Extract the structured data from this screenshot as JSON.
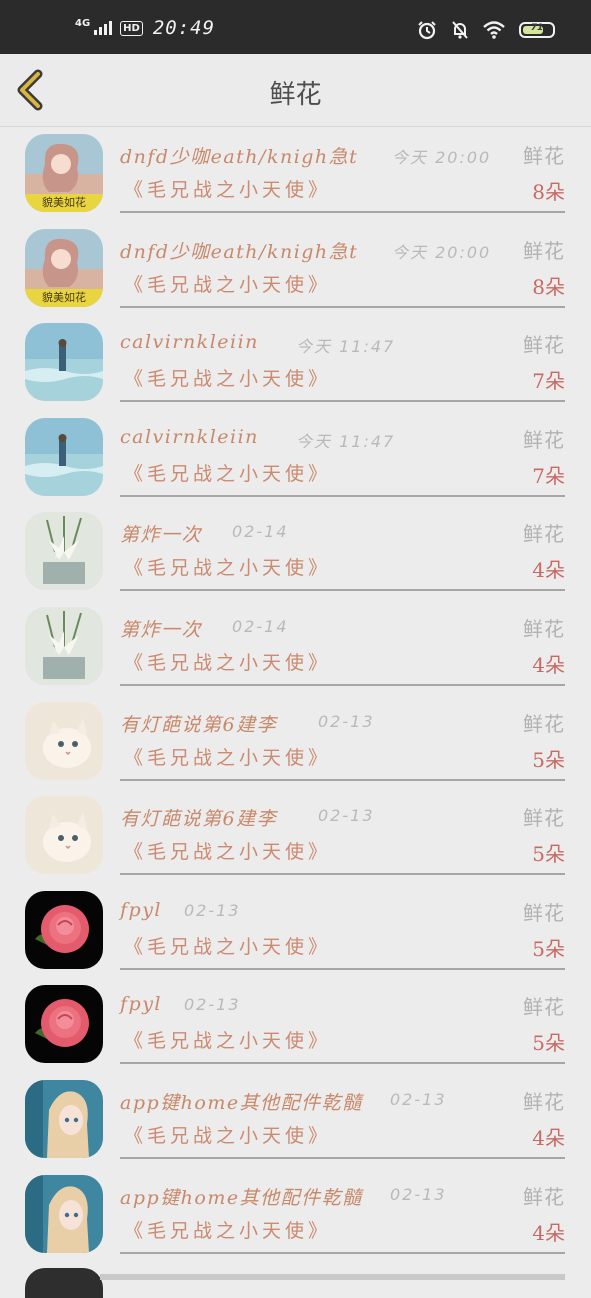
{
  "status_bar": {
    "network": "4G",
    "hd": "HD",
    "time": "20:49",
    "battery": "71"
  },
  "header": {
    "back_icon": "chevron-left-icon",
    "title": "鲜花"
  },
  "records": [
    {
      "sender": "dnfd少咖eath/knigh急t",
      "time": "今天 20:00",
      "gift": "鲜花",
      "work": "《毛兄战之小天使》",
      "count": "8朵",
      "avatar": "girl-portrait",
      "avatar_caption": "貌美如花"
    },
    {
      "sender": "dnfd少咖eath/knigh急t",
      "time": "今天 20:00",
      "gift": "鲜花",
      "work": "《毛兄战之小天使》",
      "count": "8朵",
      "avatar": "girl-portrait",
      "avatar_caption": "貌美如花"
    },
    {
      "sender": "calvirnkleiin",
      "time": "今天 11:47",
      "gift": "鲜花",
      "work": "《毛兄战之小天使》",
      "count": "7朵",
      "avatar": "sea-figure"
    },
    {
      "sender": "calvirnkleiin",
      "time": "今天 11:47",
      "gift": "鲜花",
      "work": "《毛兄战之小天使》",
      "count": "7朵",
      "avatar": "sea-figure"
    },
    {
      "sender": "第炸一次",
      "time": "02-14",
      "gift": "鲜花",
      "work": "《毛兄战之小天使》",
      "count": "4朵",
      "avatar": "lily"
    },
    {
      "sender": "第炸一次",
      "time": "02-14",
      "gift": "鲜花",
      "work": "《毛兄战之小天使》",
      "count": "4朵",
      "avatar": "lily"
    },
    {
      "sender": "有灯葩说第6建李",
      "time": "02-13",
      "gift": "鲜花",
      "work": "《毛兄战之小天使》",
      "count": "5朵",
      "avatar": "kitten"
    },
    {
      "sender": "有灯葩说第6建李",
      "time": "02-13",
      "gift": "鲜花",
      "work": "《毛兄战之小天使》",
      "count": "5朵",
      "avatar": "kitten"
    },
    {
      "sender": "fpyl",
      "time": "02-13",
      "gift": "鲜花",
      "work": "《毛兄战之小天使》",
      "count": "5朵",
      "avatar": "rose"
    },
    {
      "sender": "fpyl",
      "time": "02-13",
      "gift": "鲜花",
      "work": "《毛兄战之小天使》",
      "count": "5朵",
      "avatar": "rose"
    },
    {
      "sender": "app键home其他配件乾髓",
      "time": "02-13",
      "gift": "鲜花",
      "work": "《毛兄战之小天使》",
      "count": "4朵",
      "avatar": "anime-girl"
    },
    {
      "sender": "app键home其他配件乾髓",
      "time": "02-13",
      "gift": "鲜花",
      "work": "《毛兄战之小天使》",
      "count": "4朵",
      "avatar": "anime-girl"
    }
  ]
}
